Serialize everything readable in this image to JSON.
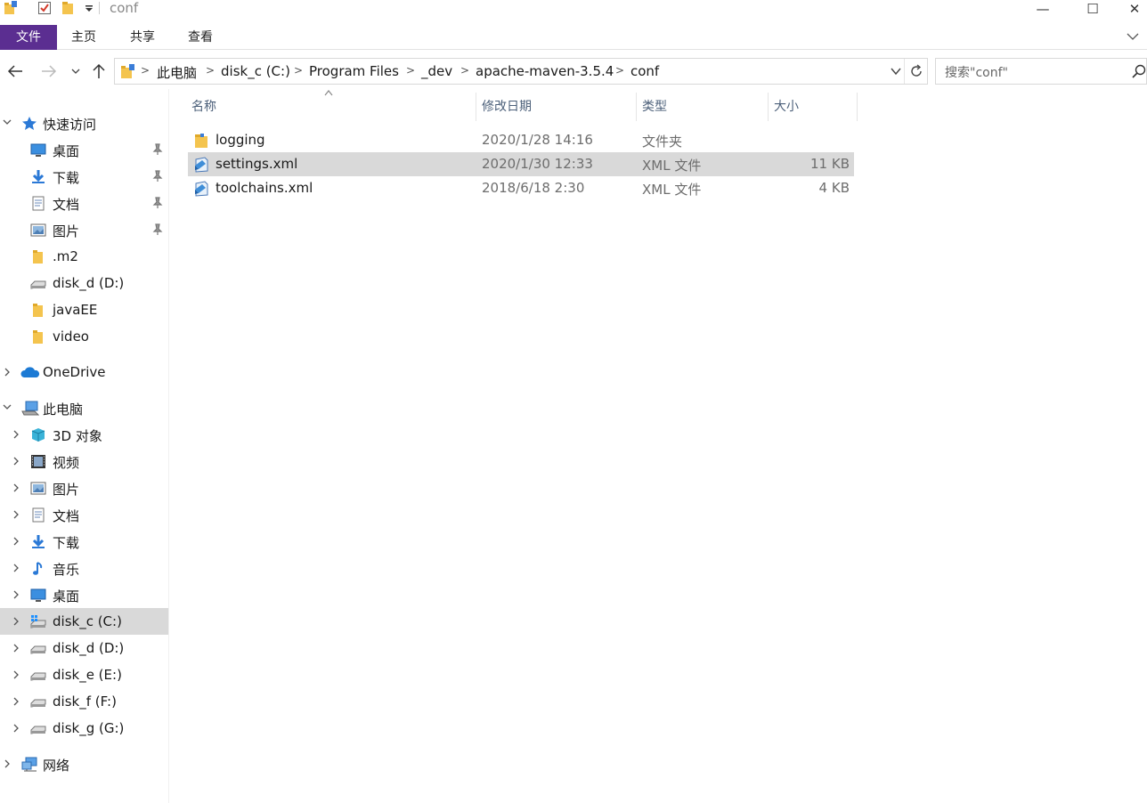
{
  "window": {
    "title": "conf",
    "minimize_glyph": "—",
    "maximize_glyph": "☐",
    "close_glyph": "✕"
  },
  "ribbon": {
    "tabs": [
      {
        "label": "文件"
      },
      {
        "label": "主页"
      },
      {
        "label": "共享"
      },
      {
        "label": "查看"
      }
    ]
  },
  "address": {
    "crumbs": [
      "此电脑",
      "disk_c (C:)",
      "Program Files",
      "_dev",
      "apache-maven-3.5.4",
      "conf"
    ],
    "search_placeholder": "搜索\"conf\""
  },
  "nav": {
    "quick_access": {
      "label": "快速访问",
      "items": [
        {
          "label": "桌面",
          "icon": "desktop-icon",
          "pinned": true
        },
        {
          "label": "下载",
          "icon": "download-icon",
          "pinned": true
        },
        {
          "label": "文档",
          "icon": "documents-icon",
          "pinned": true
        },
        {
          "label": "图片",
          "icon": "pictures-icon",
          "pinned": true
        },
        {
          "label": ".m2",
          "icon": "folder-icon",
          "pinned": false
        },
        {
          "label": "disk_d (D:)",
          "icon": "drive-icon",
          "pinned": false
        },
        {
          "label": "javaEE",
          "icon": "folder-icon",
          "pinned": false
        },
        {
          "label": "video",
          "icon": "folder-icon",
          "pinned": false
        }
      ]
    },
    "onedrive": {
      "label": "OneDrive"
    },
    "this_pc": {
      "label": "此电脑",
      "items": [
        {
          "label": "3D 对象",
          "icon": "3d-objects-icon"
        },
        {
          "label": "视频",
          "icon": "videos-icon"
        },
        {
          "label": "图片",
          "icon": "pictures-icon"
        },
        {
          "label": "文档",
          "icon": "documents-icon"
        },
        {
          "label": "下载",
          "icon": "download-icon"
        },
        {
          "label": "音乐",
          "icon": "music-icon"
        },
        {
          "label": "桌面",
          "icon": "desktop-icon"
        },
        {
          "label": "disk_c (C:)",
          "icon": "windows-drive-icon",
          "selected": true
        },
        {
          "label": "disk_d (D:)",
          "icon": "drive-icon"
        },
        {
          "label": "disk_e (E:)",
          "icon": "drive-icon"
        },
        {
          "label": "disk_f (F:)",
          "icon": "drive-icon"
        },
        {
          "label": "disk_g (G:)",
          "icon": "drive-icon"
        }
      ]
    },
    "network": {
      "label": "网络"
    }
  },
  "columns": {
    "name": "名称",
    "date": "修改日期",
    "type": "类型",
    "size": "大小"
  },
  "files": [
    {
      "name": "logging",
      "date": "2020/1/28 14:16",
      "type": "文件夹",
      "size": "",
      "icon": "folder-icon",
      "selected": false
    },
    {
      "name": "settings.xml",
      "date": "2020/1/30 12:33",
      "type": "XML 文件",
      "size": "11 KB",
      "icon": "xml-file-icon",
      "selected": true
    },
    {
      "name": "toolchains.xml",
      "date": "2018/6/18 2:30",
      "type": "XML 文件",
      "size": "4 KB",
      "icon": "xml-file-icon",
      "selected": false
    }
  ],
  "colors": {
    "file_tab_bg": "#5b2e91",
    "selection_bg": "#d9d9d9",
    "folder_yellow": "#f4c44e",
    "quick_access_star": "#2b79d6"
  }
}
